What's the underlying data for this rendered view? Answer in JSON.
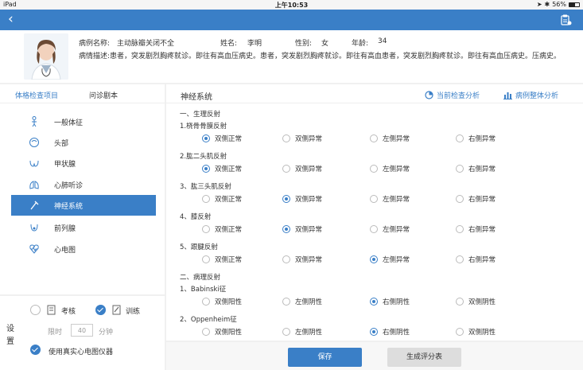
{
  "status_bar": {
    "device": "iPad",
    "time": "上午10:53",
    "battery": "56%",
    "battery_level": 0.56
  },
  "patient": {
    "case_label": "病例名称:",
    "case_name": "主动脉瓣关闭不全",
    "name_label": "姓名:",
    "name": "李明",
    "gender_label": "性别:",
    "gender": "女",
    "age_label": "年龄:",
    "age": "34",
    "desc_label": "病情描述:",
    "desc": "患者，突发剧烈胸疼就诊。即往有高血压病史。患者，突发剧烈胸疼就诊。即往有高血患者，突发剧烈胸疼就诊。即往有高血压病史。压病史。"
  },
  "left_tabs": [
    "体格检查项目",
    "问诊剧本"
  ],
  "nav_items": [
    {
      "label": "一般体征",
      "icon": "body-icon"
    },
    {
      "label": "头部",
      "icon": "head-icon"
    },
    {
      "label": "甲状腺",
      "icon": "thyroid-icon"
    },
    {
      "label": "心肺听诊",
      "icon": "lungs-icon"
    },
    {
      "label": "神经系统",
      "icon": "nerve-icon"
    },
    {
      "label": "前列腺",
      "icon": "prostate-icon"
    },
    {
      "label": "心电图",
      "icon": "ecg-icon"
    }
  ],
  "active_nav": 4,
  "settings": {
    "side_label": "设置",
    "assess_label": "考核",
    "train_label": "训练",
    "time_prefix": "限时",
    "time_value": "40",
    "time_suffix": "分钟",
    "device_label": "使用真实心电图仪器"
  },
  "main": {
    "title": "神经系统",
    "current_analysis": "当前检查分析",
    "overall_analysis": "病例整体分析",
    "sections": [
      {
        "label": "一、生理反射",
        "questions": [
          {
            "label": "1.桡骨骨膜反射",
            "options": [
              "双侧正常",
              "双侧异常",
              "左侧异常",
              "右侧异常"
            ],
            "selected": 0
          },
          {
            "label": "2.肱二头肌反射",
            "options": [
              "双侧正常",
              "双侧异常",
              "左侧异常",
              "右侧异常"
            ],
            "selected": 0
          },
          {
            "label": "3、肱三头肌反射",
            "options": [
              "双侧正常",
              "双侧异常",
              "左侧异常",
              "右侧异常"
            ],
            "selected": 1
          },
          {
            "label": "4、膝反射",
            "options": [
              "双侧正常",
              "双侧异常",
              "左侧异常",
              "右侧异常"
            ],
            "selected": 1
          },
          {
            "label": "5、跟腱反射",
            "options": [
              "双侧正常",
              "双侧异常",
              "左侧异常",
              "右侧异常"
            ],
            "selected": 2
          }
        ]
      },
      {
        "label": "二、病理反射",
        "questions": [
          {
            "label": "1、Babinski征",
            "options": [
              "双侧阳性",
              "左侧阴性",
              "右侧阴性",
              "双侧阴性"
            ],
            "selected": 2
          },
          {
            "label": "2、Oppenheim征",
            "options": [
              "双侧阳性",
              "左侧阴性",
              "右侧阴性",
              "双侧阴性"
            ],
            "selected": 2
          }
        ]
      }
    ]
  },
  "buttons": {
    "save": "保存",
    "generate": "生成评分表"
  },
  "colors": {
    "accent": "#3a7fc7"
  }
}
